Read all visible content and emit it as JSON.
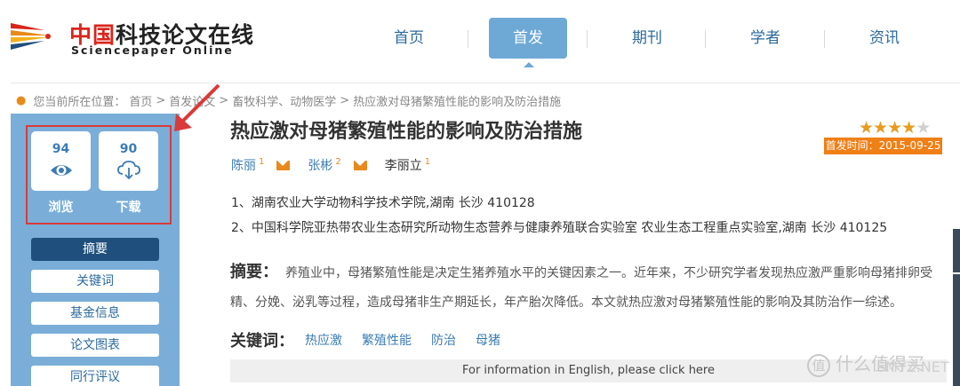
{
  "logo": {
    "cn_red": "中国",
    "cn_black": "科技论文在线",
    "en": "Sciencepaper Online"
  },
  "nav": {
    "items": [
      "首页",
      "首发",
      "期刊",
      "学者",
      "资讯"
    ],
    "active": "首发"
  },
  "breadcrumb": {
    "prefix": "您当前所在位置：",
    "items": [
      "首页",
      "首发论文",
      "畜牧科学、动物医学",
      "热应激对母猪繁殖性能的影响及防治措施"
    ],
    "separator": ">"
  },
  "stats": {
    "views": {
      "count": "94",
      "label": "浏览"
    },
    "downloads": {
      "count": "90",
      "label": "下载"
    }
  },
  "sidebar": {
    "buttons": [
      "摘要",
      "关键词",
      "基金信息",
      "论文图表",
      "同行评议"
    ],
    "active": "摘要"
  },
  "paper": {
    "title": "热应激对母猪繁殖性能的影响及防治措施",
    "rating": 4,
    "rating_max": 5,
    "pub_date": "首发时间：2015-09-25",
    "authors": [
      {
        "name": "陈丽",
        "sup": "1",
        "email": true
      },
      {
        "name": "张彬",
        "sup": "2",
        "email": true
      },
      {
        "name": "李丽立",
        "sup": "1",
        "email": false
      }
    ],
    "affiliations": [
      "1、湖南农业大学动物科学技术学院,湖南 长沙 410128",
      "2、中国科学院亚热带农业生态研究所动物生态营养与健康养殖联合实验室 农业生态工程重点实验室,湖南 长沙 410125"
    ],
    "abstract_label": "摘要：",
    "abstract": "养殖业中，母猪繁殖性能是决定生猪养殖水平的关键因素之一。近年来，不少研究学者发现热应激严重影响母猪排卵受精、分娩、泌乳等过程，造成母猪非生产期延长，年产胎次降低。本文就热应激对母猪繁殖性能的影响及其防治作一综述。",
    "keywords_label": "关键词：",
    "keywords": [
      "热应激",
      "繁殖性能",
      "防治",
      "母猪"
    ],
    "english_link": "For information in English, please click here"
  },
  "watermark": {
    "glyph": "值",
    "text": "什么值得买",
    "site": "SMYZ.NET"
  },
  "colors": {
    "brand_blue": "#3b7cb3",
    "sidebar_bg": "#7aaed8",
    "active_btn": "#1f4f7c",
    "accent_orange": "#f07f16",
    "annotation_red": "#d93a3a"
  }
}
